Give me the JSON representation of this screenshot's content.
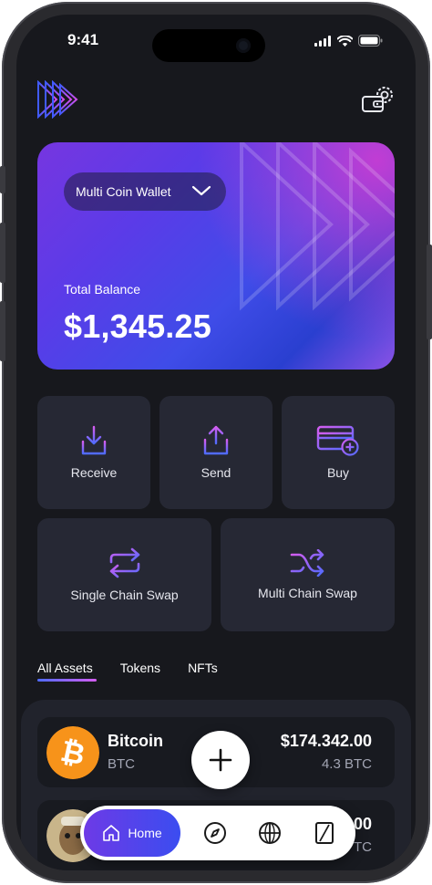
{
  "status_bar": {
    "time": "9:41"
  },
  "header": {
    "logo_icon": "triple-play-logo-icon",
    "settings_icon": "wallet-settings-gear-icon"
  },
  "wallet_card": {
    "wallet_name": "Multi Coin Wallet",
    "balance_label": "Total Balance",
    "balance_value": "$1,345.25"
  },
  "actions": [
    {
      "label": "Receive",
      "icon": "download-tray-icon"
    },
    {
      "label": "Send",
      "icon": "upload-tray-icon"
    },
    {
      "label": "Buy",
      "icon": "card-plus-icon"
    },
    {
      "label": "Single Chain Swap",
      "icon": "swap-arrows-icon"
    },
    {
      "label": "Multi Chain Swap",
      "icon": "shuffle-icon"
    }
  ],
  "tabs": [
    {
      "label": "All Assets",
      "active": true
    },
    {
      "label": "Tokens",
      "active": false
    },
    {
      "label": "NFTs",
      "active": false
    }
  ],
  "assets": [
    {
      "name": "Bitcoin",
      "symbol": "BTC",
      "value": "$174.342.00",
      "amount": "4.3 BTC",
      "logo_color": "#F7931A"
    },
    {
      "name": "",
      "symbol": "",
      "value": "00",
      "amount": "TC",
      "logo_color": "#c9b58a"
    }
  ],
  "bottom_nav": {
    "home_label": "Home",
    "items": [
      "home-icon",
      "compass-icon",
      "globe-icon",
      "card-slash-icon"
    ]
  },
  "colors": {
    "background": "#17181d",
    "tile": "#262834",
    "accent_start": "#6d3ae6",
    "accent_end": "#3b4df0",
    "icon_gradient_start": "#4f6bff",
    "icon_gradient_end": "#d45df0"
  }
}
